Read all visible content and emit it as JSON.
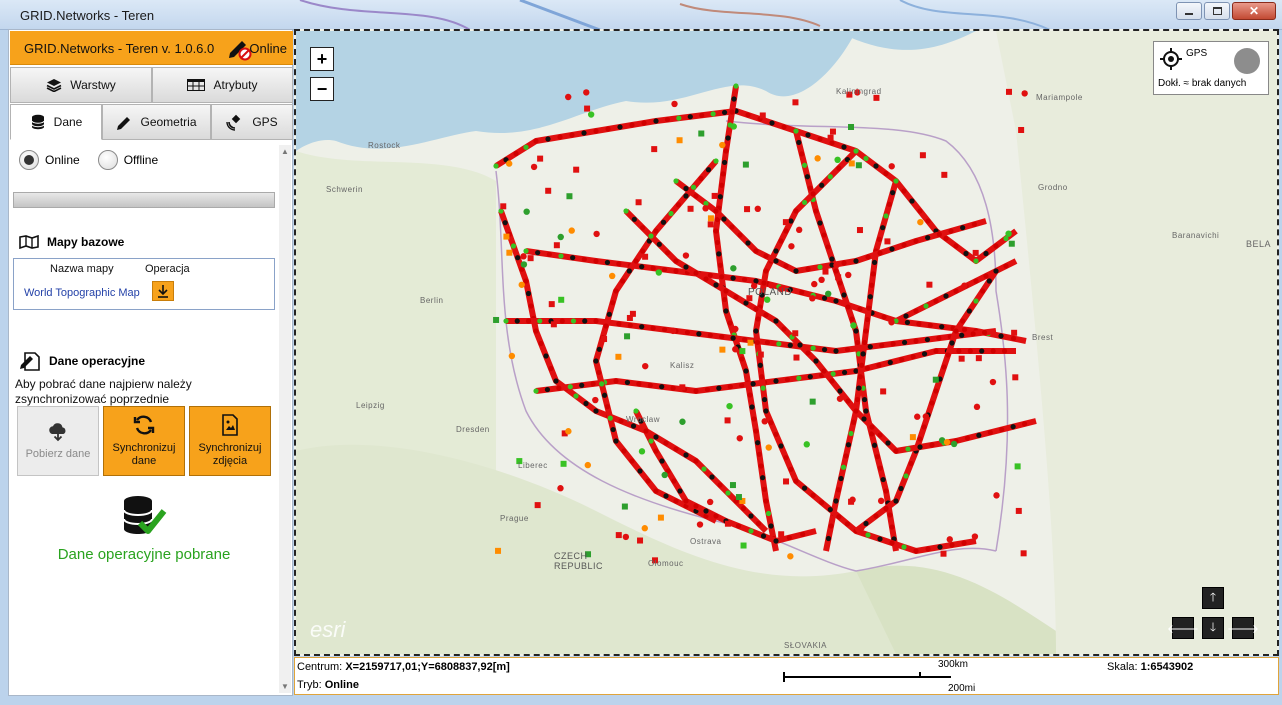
{
  "window": {
    "title": "GRID.Networks - Teren"
  },
  "header": {
    "app_name": "GRID.Networks - Teren v. 1.0.6.0",
    "status": "Online"
  },
  "toolbar": {
    "layers": "Warstwy",
    "attributes": "Atrybuty"
  },
  "tabs": [
    {
      "label": "Dane"
    },
    {
      "label": "Geometria"
    },
    {
      "label": "GPS"
    }
  ],
  "connection": {
    "online": "Online",
    "offline": "Offline",
    "selected": "Online"
  },
  "base_maps": {
    "title": "Mapy bazowe",
    "col_name": "Nazwa mapy",
    "col_op": "Operacja",
    "rows": [
      {
        "name": "World Topographic Map"
      }
    ]
  },
  "operational": {
    "title": "Dane operacyjne",
    "hint": "Aby pobrać dane najpierw należy zsynchronizować poprzednie",
    "buttons": [
      {
        "label": "Pobierz dane",
        "enabled": false
      },
      {
        "label": "Synchronizuj dane",
        "enabled": true
      },
      {
        "label": "Synchronizuj zdjęcia",
        "enabled": true
      }
    ],
    "status": "Dane operacyjne pobrane"
  },
  "map": {
    "gps_label": "GPS",
    "accuracy": "Dokł. ≈ brak danych",
    "labels": [
      "Kaliningrad",
      "POLAND",
      "Berlin",
      "Dresden",
      "Prague",
      "CZECH REPUBLIC",
      "SŁOVAKIA",
      "Brest",
      "Grodno",
      "BELA",
      "Rostock",
      "Schwerin",
      "Leipzig",
      "Mariampole",
      "Baranavichi",
      "Ostrava",
      "Olomouc",
      "Liberec",
      "Wroclaw",
      "Kalisz"
    ],
    "watermark": "esri"
  },
  "statusbar": {
    "centrum_label": "Centrum:",
    "centrum_value": "X=2159717,01;Y=6808837,92[m]",
    "mode_label": "Tryb:",
    "mode_value": "Online",
    "scale_label": "Skala:",
    "scale_value": "1:6543902",
    "scale_km": "300km",
    "scale_mi": "200mi"
  },
  "colors": {
    "accent": "#f7a21b",
    "success": "#2aa31f",
    "line": "#e01010"
  }
}
